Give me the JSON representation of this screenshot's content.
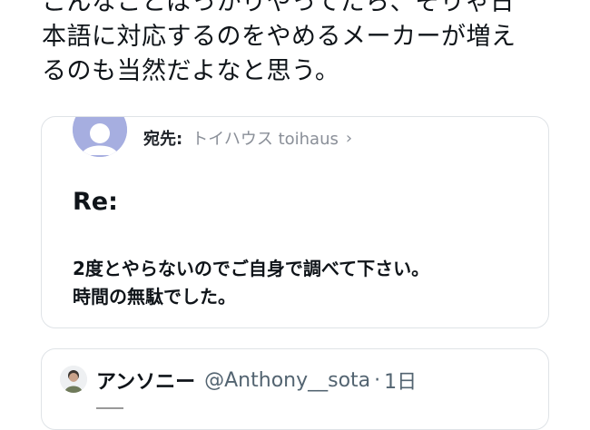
{
  "tweet": {
    "lines": [
      "こんなことばっかりやってたら、そりゃ日",
      "本語に対応するのをやめるメーカーが増え",
      "るのも当然だよなと思う。"
    ]
  },
  "email": {
    "to_label": "宛先:",
    "to_name": "トイハウス toihaus",
    "subject": "Re:",
    "body": [
      "2度とやらないのでご自身で調べて下さい。",
      "時間の無駄でした。"
    ]
  },
  "quote": {
    "name": "アンソニー",
    "handle": "@Anthony__sota",
    "separator": "·",
    "time": "1日"
  },
  "colors": {
    "text": "#0f1419",
    "secondary": "#536471",
    "border": "#dfe3e7",
    "avatar": "#a6aee0"
  },
  "icons": {
    "to_chevron": "chevron-right-icon",
    "mail_avatar": "default-avatar-icon"
  }
}
